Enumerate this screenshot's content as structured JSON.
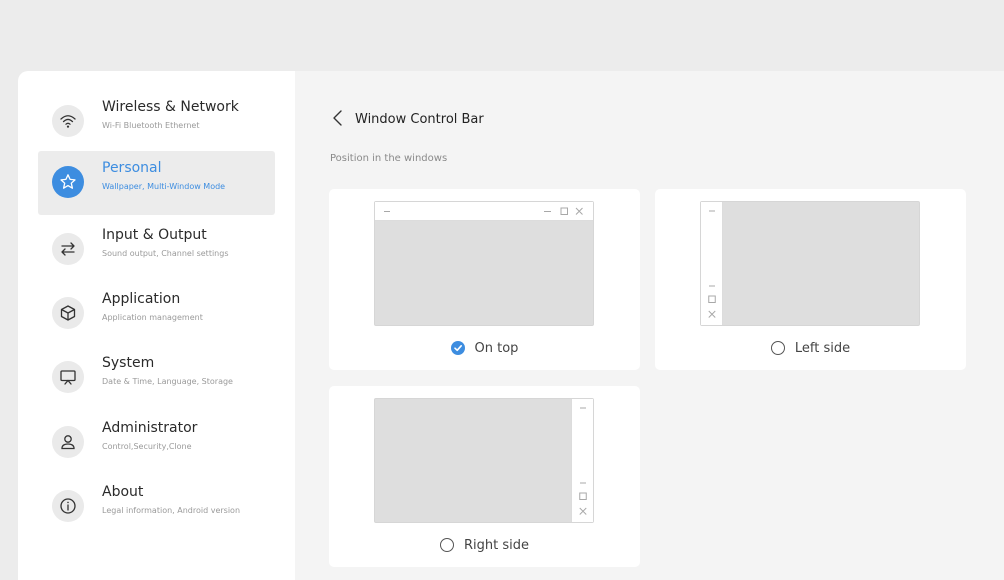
{
  "sidebar": {
    "items": [
      {
        "title": "Wireless & Network",
        "subtitle": "Wi-Fi Bluetooth Ethernet",
        "icon": "wifi-icon",
        "active": false
      },
      {
        "title": "Personal",
        "subtitle": "Wallpaper, Multi-Window Mode",
        "icon": "star-icon",
        "active": true
      },
      {
        "title": "Input & Output",
        "subtitle": "Sound output, Channel settings",
        "icon": "swap-arrows-icon",
        "active": false
      },
      {
        "title": "Application",
        "subtitle": "Application management",
        "icon": "cube-icon",
        "active": false
      },
      {
        "title": "System",
        "subtitle": "Date & Time, Language, Storage",
        "icon": "monitor-icon",
        "active": false
      },
      {
        "title": "Administrator",
        "subtitle": "Control,Security,Clone",
        "icon": "user-icon",
        "active": false
      },
      {
        "title": "About",
        "subtitle": "Legal information, Android version",
        "icon": "info-icon",
        "active": false
      }
    ]
  },
  "main": {
    "title": "Window Control Bar",
    "section_label": "Position in the windows",
    "options": [
      {
        "label": "On top",
        "selected": true
      },
      {
        "label": "Left side",
        "selected": false
      },
      {
        "label": "Right side",
        "selected": false
      }
    ]
  },
  "colors": {
    "accent": "#3d8de0",
    "sidebar_active_bg": "#ececec",
    "content_bg": "#f4f4f4",
    "page_bg": "#ececec"
  }
}
